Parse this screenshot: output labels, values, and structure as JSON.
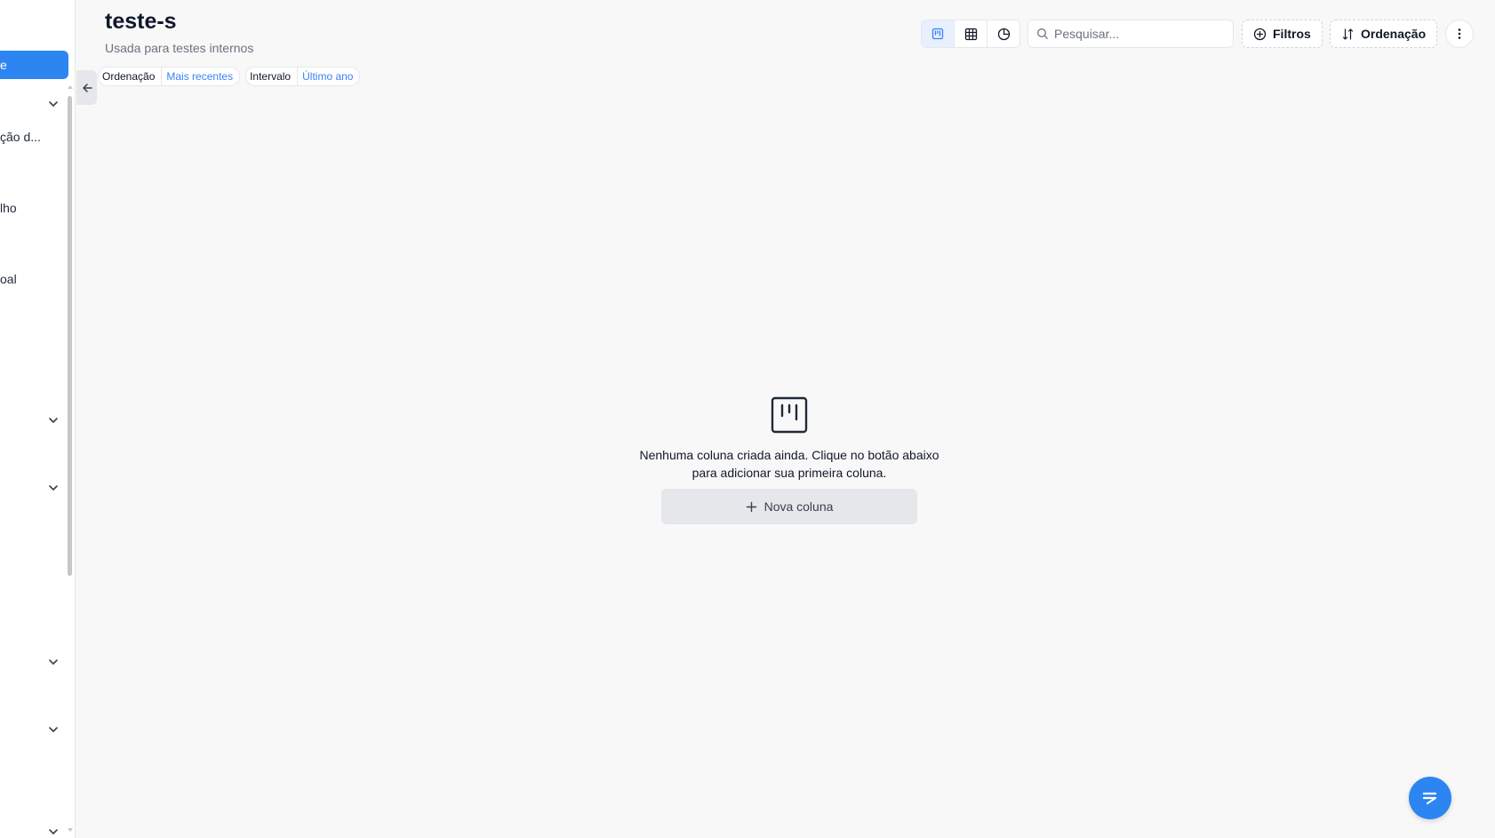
{
  "sidebar": {
    "active_item": "e",
    "items": [
      {
        "label": "ção d..."
      },
      {
        "label": "lho"
      },
      {
        "label": "oal"
      }
    ]
  },
  "header": {
    "title": "teste-s",
    "subtitle": "Usada para testes internos",
    "chips": [
      {
        "key": "Ordenação",
        "value": "Mais recentes"
      },
      {
        "key": "Intervalo",
        "value": "Último ano"
      }
    ]
  },
  "toolbar": {
    "search_placeholder": "Pesquisar...",
    "filters_label": "Filtros",
    "sort_label": "Ordenação"
  },
  "empty_state": {
    "line1": "Nenhuma coluna criada ainda. Clique no botão abaixo",
    "line2": "para adicionar sua primeira coluna.",
    "button_label": "Nova coluna"
  },
  "colors": {
    "accent": "#2d85f2",
    "chip_value": "#3b82f6"
  }
}
